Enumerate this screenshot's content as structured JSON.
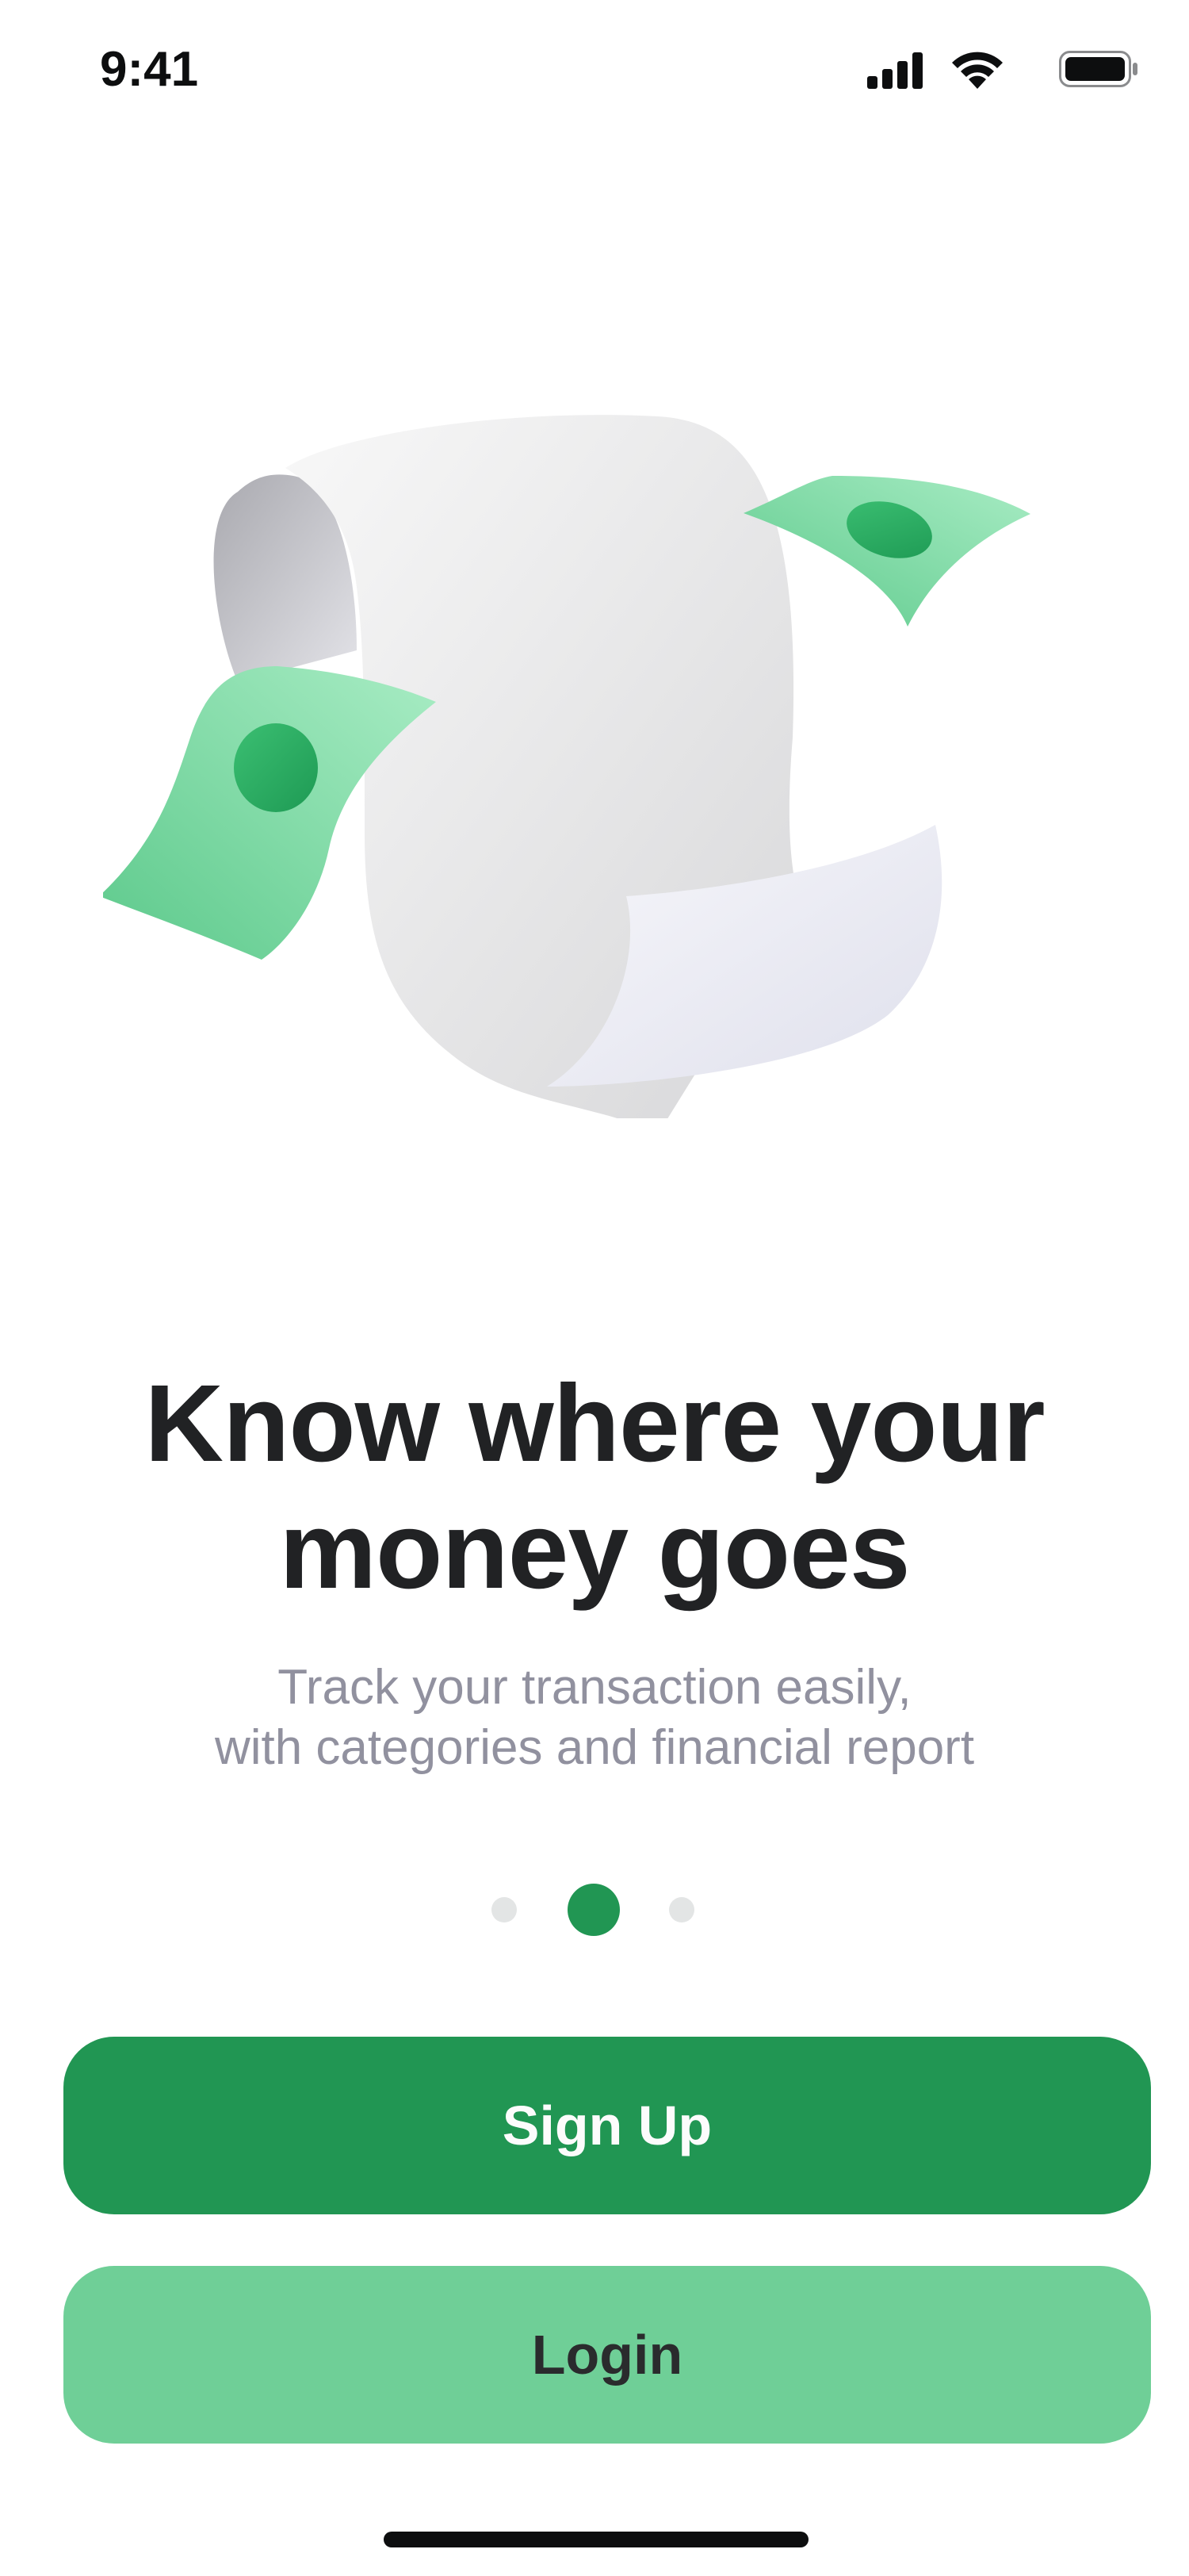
{
  "status_bar": {
    "time": "9:41",
    "icons": [
      "cellular-signal-icon",
      "wifi-icon",
      "battery-icon"
    ]
  },
  "illustration": {
    "icon": "receipt-with-money-illustration"
  },
  "onboarding": {
    "headline_line1": "Know where your",
    "headline_line2": "money goes",
    "subtitle_line1": "Track your transaction easily,",
    "subtitle_line2": "with categories and financial report",
    "pager": {
      "total_pages": 3,
      "active_page": 2
    }
  },
  "actions": {
    "signup_label": "Sign Up",
    "login_label": "Login"
  },
  "colors": {
    "primary": "#219653",
    "secondary": "#6fcf97",
    "text_dark": "#212224",
    "text_muted": "#91919f",
    "dot_inactive": "#e3e5e5"
  }
}
